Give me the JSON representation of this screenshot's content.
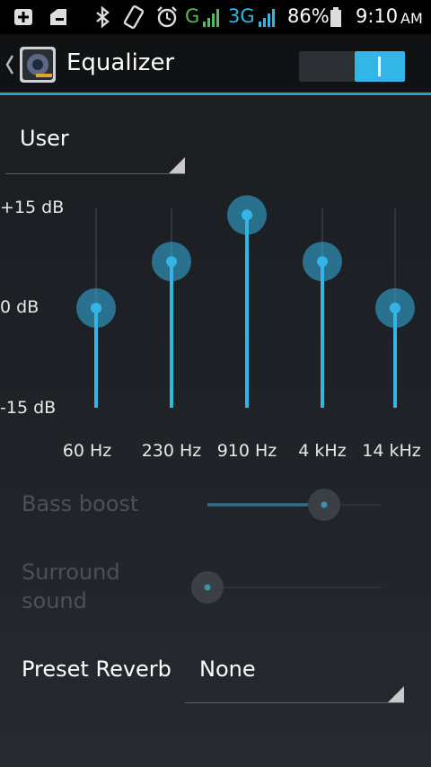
{
  "status_bar": {
    "network_g": "G",
    "network_3g": "3G",
    "battery": "86%",
    "time": "9:10",
    "ampm": "AM"
  },
  "header": {
    "title": "Equalizer",
    "toggle_on": true
  },
  "preset": {
    "selected": "User"
  },
  "db_labels": {
    "top": "+15 dB",
    "middle": "0 dB",
    "bottom": "-15 dB"
  },
  "bands": [
    {
      "freq": "60 Hz",
      "level_db": 0
    },
    {
      "freq": "230 Hz",
      "level_db": 7
    },
    {
      "freq": "910 Hz",
      "level_db": 14
    },
    {
      "freq": "4 kHz",
      "level_db": 7
    },
    {
      "freq": "14 kHz",
      "level_db": 0
    }
  ],
  "effects": {
    "bass_boost_label": "Bass boost",
    "bass_boost_level": 0.67,
    "surround_label_line1": "Surround",
    "surround_label_line2": "sound",
    "surround_level": 0.0,
    "enabled": false
  },
  "reverb": {
    "label": "Preset Reverb",
    "value": "None"
  },
  "colors": {
    "accent": "#33b5e5",
    "track": "#3a3f45",
    "disabled": "#4c5057"
  }
}
